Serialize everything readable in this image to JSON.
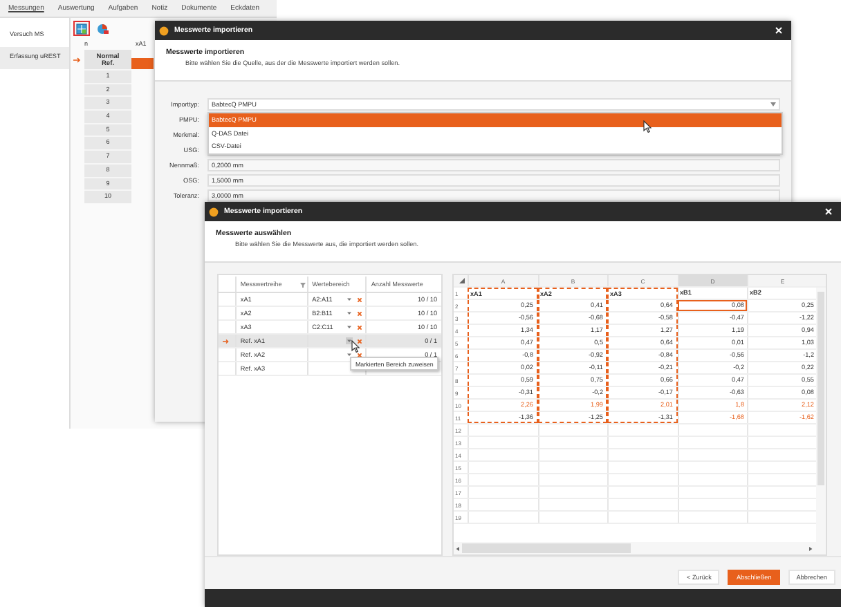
{
  "app": {
    "menu": [
      {
        "label": "Messungen",
        "selected": true
      },
      {
        "label": "Auswertung",
        "selected": false
      },
      {
        "label": "Aufgaben",
        "selected": false
      },
      {
        "label": "Notiz",
        "selected": false
      },
      {
        "label": "Dokumente",
        "selected": false
      },
      {
        "label": "Eckdaten",
        "selected": false
      }
    ],
    "sidebar": [
      {
        "label": "Versuch MS",
        "selected": false
      },
      {
        "label": "Erfassung uREST",
        "selected": true
      }
    ],
    "toolbar": [
      {
        "kind": "import",
        "selected": true
      },
      {
        "kind": "chart",
        "selected": false
      }
    ],
    "grid": {
      "columns": [
        "n",
        "xA1"
      ],
      "header": [
        "Normal",
        "Ref."
      ],
      "rows": [
        "1",
        "2",
        "3",
        "4",
        "5",
        "6",
        "7",
        "8",
        "9",
        "10"
      ]
    }
  },
  "source_dialog": {
    "title": "Messwerte importieren",
    "heading": "Messwerte importieren",
    "subtitle": "Bitte wählen Sie die Quelle, aus der die Messwerte importiert werden sollen.",
    "fields": [
      {
        "label": "Importtyp:",
        "value": "BabtecQ PMPU",
        "kind": "dropdown"
      },
      {
        "label": "PMPU:",
        "kind": "text"
      },
      {
        "label": "Merkmal:",
        "kind": "text"
      },
      {
        "label": "USG:",
        "kind": "text"
      },
      {
        "label": "Nennmaß:",
        "value": "0,2000 mm",
        "kind": "text"
      },
      {
        "label": "OSG:",
        "value": "1,5000 mm",
        "kind": "text"
      },
      {
        "label": "Toleranz:",
        "value": "3,0000 mm",
        "kind": "text"
      }
    ],
    "options": [
      {
        "label": "BabtecQ PMPU",
        "selected": true
      },
      {
        "label": "Q-DAS Datei",
        "selected": false
      },
      {
        "label": "CSV-Datei",
        "selected": false
      }
    ]
  },
  "select_dialog": {
    "title": "Messwerte importieren",
    "heading": "Messwerte auswählen",
    "subtitle": "Bitte wählen Sie die Messwerte aus, die importiert werden sollen.",
    "table": {
      "columns": [
        "Messwertreihe",
        "Wertebereich",
        "Anzahl Messwerte"
      ],
      "rows": [
        {
          "name": "xA1",
          "range": "A2:A11",
          "count": "10 / 10",
          "selected": false,
          "clearable": true
        },
        {
          "name": "xA2",
          "range": "B2:B11",
          "count": "10 / 10",
          "selected": false,
          "clearable": true
        },
        {
          "name": "xA3",
          "range": "C2:C11",
          "count": "10 / 10",
          "selected": false,
          "clearable": true
        },
        {
          "name": "Ref. xA1",
          "count": "0 / 1",
          "selected": true,
          "clearable": true
        },
        {
          "name": "Ref. xA2",
          "count": "0 / 1",
          "selected": false,
          "clearable": true
        },
        {
          "name": "Ref. xA3",
          "selected": false,
          "clearable": false
        }
      ]
    },
    "tooltip": "Markierten Bereich zuweisen",
    "sheet": {
      "columns": [
        {
          "label": "A",
          "marked": true,
          "selected": false
        },
        {
          "label": "B",
          "marked": true,
          "selected": false
        },
        {
          "label": "C",
          "marked": true,
          "selected": false
        },
        {
          "label": "D",
          "marked": false,
          "selected": true
        },
        {
          "label": "E",
          "marked": false,
          "selected": false
        }
      ],
      "rows": [
        {
          "number": "1",
          "kind": "header",
          "cells": [
            {
              "text": "xA1",
              "outlier": false,
              "selected": false
            },
            {
              "text": "xA2",
              "outlier": false,
              "selected": false
            },
            {
              "text": "xA3",
              "outlier": false,
              "selected": false
            },
            {
              "text": "xB1",
              "outlier": false,
              "selected": false
            },
            {
              "text": "xB2",
              "outlier": false,
              "selected": false
            }
          ]
        },
        {
          "number": "2",
          "kind": "value",
          "cells": [
            {
              "text": "0,25",
              "outlier": false,
              "selected": false
            },
            {
              "text": "0,41",
              "outlier": false,
              "selected": false
            },
            {
              "text": "0,64",
              "outlier": false,
              "selected": false
            },
            {
              "text": "0,08",
              "outlier": false,
              "selected": true
            },
            {
              "text": "0,25",
              "outlier": false,
              "selected": false
            }
          ]
        },
        {
          "number": "3",
          "kind": "value",
          "cells": [
            {
              "text": "-0,56",
              "outlier": false,
              "selected": false
            },
            {
              "text": "-0,68",
              "outlier": false,
              "selected": false
            },
            {
              "text": "-0,58",
              "outlier": false,
              "selected": false
            },
            {
              "text": "-0,47",
              "outlier": false,
              "selected": false
            },
            {
              "text": "-1,22",
              "outlier": false,
              "selected": false
            }
          ]
        },
        {
          "number": "4",
          "kind": "value",
          "cells": [
            {
              "text": "1,34",
              "outlier": false,
              "selected": false
            },
            {
              "text": "1,17",
              "outlier": false,
              "selected": false
            },
            {
              "text": "1,27",
              "outlier": false,
              "selected": false
            },
            {
              "text": "1,19",
              "outlier": false,
              "selected": false
            },
            {
              "text": "0,94",
              "outlier": false,
              "selected": false
            }
          ]
        },
        {
          "number": "5",
          "kind": "value",
          "cells": [
            {
              "text": "0,47",
              "outlier": false,
              "selected": false
            },
            {
              "text": "0,5",
              "outlier": false,
              "selected": false
            },
            {
              "text": "0,64",
              "outlier": false,
              "selected": false
            },
            {
              "text": "0,01",
              "outlier": false,
              "selected": false
            },
            {
              "text": "1,03",
              "outlier": false,
              "selected": false
            }
          ]
        },
        {
          "number": "6",
          "kind": "value",
          "cells": [
            {
              "text": "-0,8",
              "outlier": false,
              "selected": false
            },
            {
              "text": "-0,92",
              "outlier": false,
              "selected": false
            },
            {
              "text": "-0,84",
              "outlier": false,
              "selected": false
            },
            {
              "text": "-0,56",
              "outlier": false,
              "selected": false
            },
            {
              "text": "-1,2",
              "outlier": false,
              "selected": false
            }
          ]
        },
        {
          "number": "7",
          "kind": "value",
          "cells": [
            {
              "text": "0,02",
              "outlier": false,
              "selected": false
            },
            {
              "text": "-0,11",
              "outlier": false,
              "selected": false
            },
            {
              "text": "-0,21",
              "outlier": false,
              "selected": false
            },
            {
              "text": "-0,2",
              "outlier": false,
              "selected": false
            },
            {
              "text": "0,22",
              "outlier": false,
              "selected": false
            }
          ]
        },
        {
          "number": "8",
          "kind": "value",
          "cells": [
            {
              "text": "0,59",
              "outlier": false,
              "selected": false
            },
            {
              "text": "0,75",
              "outlier": false,
              "selected": false
            },
            {
              "text": "0,66",
              "outlier": false,
              "selected": false
            },
            {
              "text": "0,47",
              "outlier": false,
              "selected": false
            },
            {
              "text": "0,55",
              "outlier": false,
              "selected": false
            }
          ]
        },
        {
          "number": "9",
          "kind": "value",
          "cells": [
            {
              "text": "-0,31",
              "outlier": false,
              "selected": false
            },
            {
              "text": "-0,2",
              "outlier": false,
              "selected": false
            },
            {
              "text": "-0,17",
              "outlier": false,
              "selected": false
            },
            {
              "text": "-0,63",
              "outlier": false,
              "selected": false
            },
            {
              "text": "0,08",
              "outlier": false,
              "selected": false
            }
          ]
        },
        {
          "number": "10",
          "kind": "value",
          "cells": [
            {
              "text": "2,26",
              "outlier": true,
              "selected": false
            },
            {
              "text": "1,99",
              "outlier": true,
              "selected": false
            },
            {
              "text": "2,01",
              "outlier": true,
              "selected": false
            },
            {
              "text": "1,8",
              "outlier": true,
              "selected": false
            },
            {
              "text": "2,12",
              "outlier": true,
              "selected": false
            }
          ]
        },
        {
          "number": "11",
          "kind": "value",
          "cells": [
            {
              "text": "-1,36",
              "outlier": false,
              "selected": false
            },
            {
              "text": "-1,25",
              "outlier": false,
              "selected": false
            },
            {
              "text": "-1,31",
              "outlier": false,
              "selected": false
            },
            {
              "text": "-1,68",
              "outlier": true,
              "selected": false
            },
            {
              "text": "-1,62",
              "outlier": true,
              "selected": false
            }
          ]
        },
        {
          "number": "12",
          "kind": "empty"
        },
        {
          "number": "13",
          "kind": "empty"
        },
        {
          "number": "14",
          "kind": "empty"
        },
        {
          "number": "15",
          "kind": "empty"
        },
        {
          "number": "16",
          "kind": "empty"
        },
        {
          "number": "17",
          "kind": "empty"
        },
        {
          "number": "18",
          "kind": "empty"
        },
        {
          "number": "19",
          "kind": "empty"
        }
      ]
    },
    "buttons": [
      {
        "label": "< Zurück",
        "kind": "secondary"
      },
      {
        "label": "Abschließen",
        "kind": "primary"
      },
      {
        "label": "Abbrechen",
        "kind": "secondary"
      }
    ]
  }
}
